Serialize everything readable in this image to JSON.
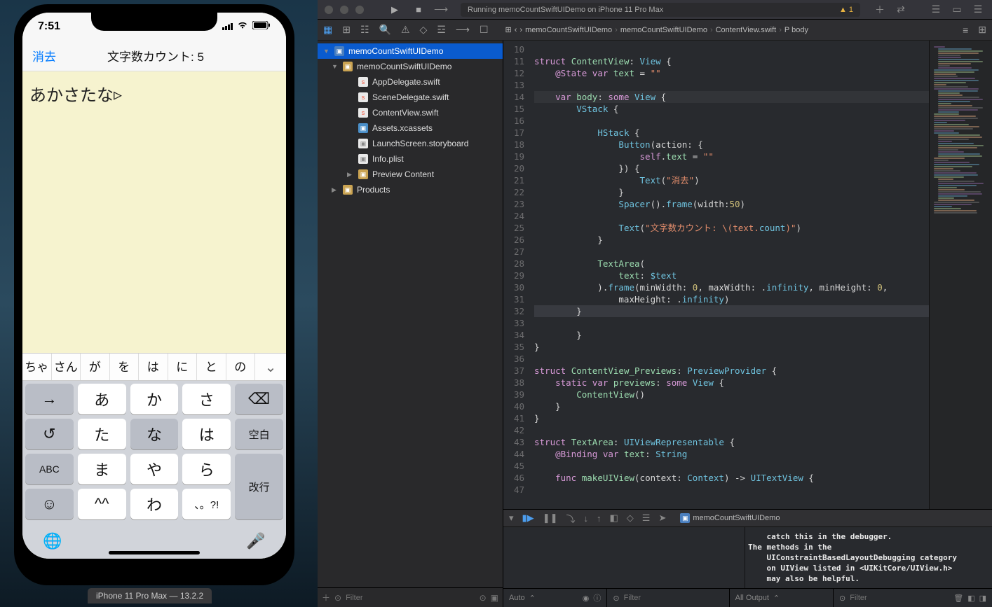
{
  "simulator": {
    "time": "7:51",
    "clearLabel": "消去",
    "countLabel": "文字数カウント: 5",
    "text": "あかさたな",
    "suggestions": [
      "ちゃん",
      "さん",
      "が",
      "を",
      "は",
      "に",
      "と",
      "の"
    ],
    "keyboard": {
      "r1": [
        "→",
        "あ",
        "か",
        "さ",
        "⌫"
      ],
      "r2": [
        "↺",
        "た",
        "な",
        "は",
        "空白"
      ],
      "r3": [
        "ABC",
        "ま",
        "や",
        "ら",
        "改行"
      ],
      "r4": [
        "☺",
        "^^",
        "わ",
        "、。?!",
        ""
      ]
    },
    "deviceLabel": "iPhone 11 Pro Max — 13.2.2"
  },
  "xcode": {
    "status": "Running memoCountSwiftUIDemo on iPhone 11 Pro Max",
    "warnCount": "1",
    "breadcrumb": [
      "memoCountSwiftUIDemo",
      "memoCountSwiftUIDemo",
      "ContentView.swift",
      "P body"
    ],
    "nav": {
      "root": "memoCountSwiftUIDemo",
      "group": "memoCountSwiftUIDemo",
      "files": [
        "AppDelegate.swift",
        "SceneDelegate.swift",
        "ContentView.swift",
        "Assets.xcassets",
        "LaunchScreen.storyboard",
        "Info.plist"
      ],
      "preview": "Preview Content",
      "products": "Products",
      "filterPlaceholder": "Filter"
    },
    "code": {
      "startLine": 10,
      "lines": [
        "",
        "struct ContentView: View {",
        "    @State var text = \"\"",
        "",
        "    var body: some View {",
        "        VStack {",
        "",
        "            HStack {",
        "                Button(action: {",
        "                    self.text = \"\"",
        "                }) {",
        "                    Text(\"消去\")",
        "                }",
        "                Spacer().frame(width:50)",
        "",
        "                Text(\"文字数カウント: \\(text.count)\")",
        "            }",
        "",
        "            TextArea(",
        "                text: $text",
        "            ).frame(minWidth: 0, maxWidth: .infinity, minHeight: 0,",
        "                maxHeight: .infinity)",
        "        }",
        "",
        "        }",
        "}",
        "",
        "struct ContentView_Previews: PreviewProvider {",
        "    static var previews: some View {",
        "        ContentView()",
        "    }",
        "}",
        "",
        "struct TextArea: UIViewRepresentable {",
        "    @Binding var text: String",
        "",
        "    func makeUIView(context: Context) -> UITextView {",
        ""
      ]
    },
    "debug": {
      "bcApp": "memoCountSwiftUIDemo",
      "console": "    catch this in the debugger.\nThe methods in the\n    UIConstraintBasedLayoutDebugging category\n    on UIView listed in <UIKitCore/UIView.h>\n    may also be helpful.",
      "autoLabel": "Auto",
      "allOutputLabel": "All Output",
      "filterPlaceholder": "Filter"
    }
  }
}
